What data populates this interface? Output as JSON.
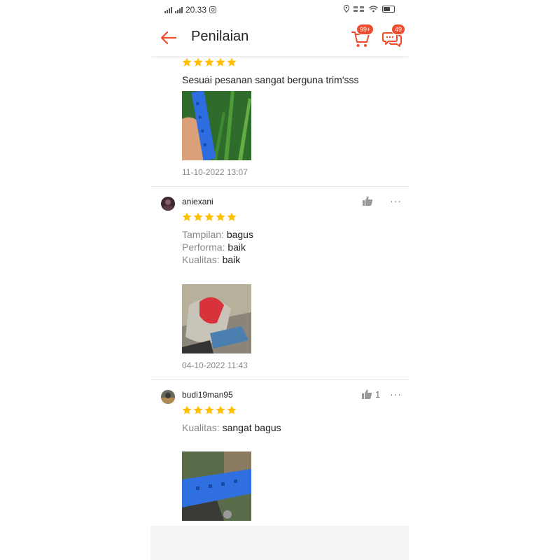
{
  "status_bar": {
    "time": "20.33"
  },
  "header": {
    "title": "Penilaian",
    "cart_badge": "99+",
    "chat_badge": "49"
  },
  "reviews": [
    {
      "rating": 5,
      "comment": "Sesuai pesanan sangat berguna trim'sss",
      "date": "11-10-2022 13:07"
    },
    {
      "username": "aniexani",
      "rating": 5,
      "attributes": [
        {
          "label": "Tampilan:",
          "value": "bagus"
        },
        {
          "label": "Performa:",
          "value": "baik"
        },
        {
          "label": "Kualitas:",
          "value": "baik"
        }
      ],
      "date": "04-10-2022 11:43"
    },
    {
      "username": "budi19man95",
      "rating": 5,
      "likes": "1",
      "attributes": [
        {
          "label": "Kualitas:",
          "value": "sangat bagus"
        }
      ]
    }
  ],
  "colors": {
    "accent": "#ee4d2d",
    "star": "#ffbf00",
    "meta_text": "#888888"
  },
  "icons": [
    "back-arrow-icon",
    "cart-icon",
    "chat-icon",
    "thumbs-up-icon",
    "more-options-icon",
    "star-icon"
  ]
}
